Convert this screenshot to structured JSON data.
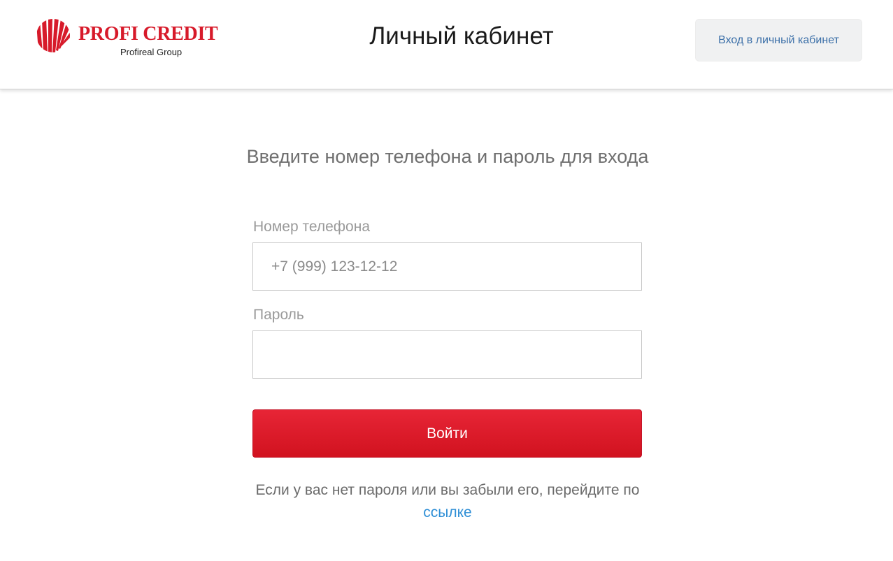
{
  "brand": {
    "name": "PROFI CREDIT",
    "group": "Profireal Group",
    "color": "#d71a2a",
    "icon": "radiating-stripes-logo-icon"
  },
  "header": {
    "title": "Личный кабинет",
    "login_button_label": "Вход в личный кабинет"
  },
  "form": {
    "heading": "Введите номер телефона и пароль для входа",
    "phone": {
      "label": "Номер телефона",
      "value": "",
      "placeholder": "+7 (999) 123-12-12"
    },
    "password": {
      "label": "Пароль",
      "value": "",
      "placeholder": ""
    },
    "submit_label": "Войти",
    "submit_color": "#e21f30"
  },
  "help": {
    "text": "Если у вас нет пароля или вы забыли его, перейдите по ",
    "link_text": "ссылке",
    "link_color": "#2f8fd6"
  }
}
